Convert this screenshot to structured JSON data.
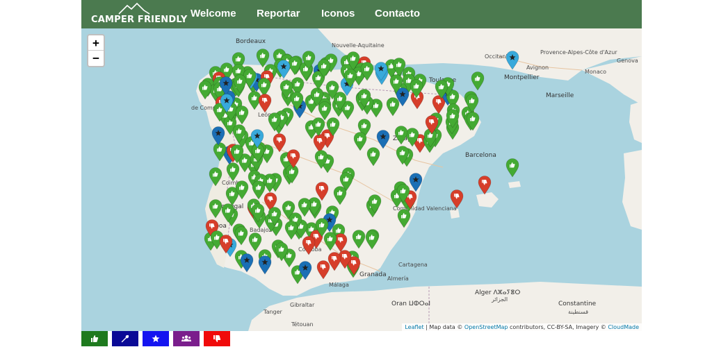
{
  "navbar": {
    "logo_text": "CAMPER FRIENDLY",
    "links": [
      {
        "label": "Welcome"
      },
      {
        "label": "Reportar"
      },
      {
        "label": "Iconos"
      },
      {
        "label": "Contacto"
      }
    ],
    "background": "#4b7a4f"
  },
  "map": {
    "zoom_in": "+",
    "zoom_out": "−",
    "labels": [
      {
        "text": "Bordeaux",
        "kind": "city"
      },
      {
        "text": "Toulouse",
        "kind": "city"
      },
      {
        "text": "Montpellier",
        "kind": "city"
      },
      {
        "text": "Avignon",
        "kind": "city"
      },
      {
        "text": "Marseille",
        "kind": "city"
      },
      {
        "text": "Monaco",
        "kind": "city"
      },
      {
        "text": "Genova",
        "kind": "city"
      },
      {
        "text": "Nouvelle-Aquitaine",
        "kind": "region"
      },
      {
        "text": "Occitanie",
        "kind": "region"
      },
      {
        "text": "Provence-Alpes-Côte d'Azur",
        "kind": "region"
      },
      {
        "text": "de Compostela",
        "kind": "city"
      },
      {
        "text": "León",
        "kind": "city"
      },
      {
        "text": "Zaragoza",
        "kind": "city"
      },
      {
        "text": "Barcelona",
        "kind": "city"
      },
      {
        "text": "Coimbra",
        "kind": "city"
      },
      {
        "text": "Portugal",
        "kind": "country"
      },
      {
        "text": "Lisboa",
        "kind": "city"
      },
      {
        "text": "Badajoz",
        "kind": "city"
      },
      {
        "text": "Comunidad Valenciana",
        "kind": "region"
      },
      {
        "text": "Córdoba",
        "kind": "city"
      },
      {
        "text": "Granada",
        "kind": "city"
      },
      {
        "text": "Málaga",
        "kind": "city"
      },
      {
        "text": "Almería",
        "kind": "city"
      },
      {
        "text": "Cartagena",
        "kind": "city"
      },
      {
        "text": "Gibraltar",
        "kind": "city"
      },
      {
        "text": "Oran ⵡⵀⵔⴰⵏ",
        "kind": "city"
      },
      {
        "text": "Alger ⴷⵣⴰⵢⴻⵔ",
        "kind": "city"
      },
      {
        "text": "Constantine",
        "kind": "city"
      },
      {
        "text": "Tétouan",
        "kind": "city"
      },
      {
        "text": "Tanger",
        "kind": "city"
      },
      {
        "text": "الجزائر",
        "kind": "city"
      },
      {
        "text": "قسنطينة",
        "kind": "city"
      }
    ],
    "attribution": {
      "leaflet": "Leaflet",
      "text1": " | Map data © ",
      "osm": "OpenStreetMap",
      "text2": " contributors, CC-BY-SA, Imagery © ",
      "cloudmade": "CloudMade"
    },
    "marker_colors": {
      "thumbs_up": "#44aa33",
      "thumbs_down": "#d63e2a",
      "service": "#1b6fb5",
      "favorite": "#38a9db"
    }
  },
  "filters": [
    {
      "name": "thumbs-up",
      "color": "#1e7a1e",
      "icon": "thumbs-up-icon"
    },
    {
      "name": "service",
      "color": "#0a0a96",
      "icon": "wrench-icon"
    },
    {
      "name": "favorite",
      "color": "#1414f0",
      "icon": "star-icon"
    },
    {
      "name": "community",
      "color": "#7a1e8c",
      "icon": "users-icon"
    },
    {
      "name": "thumbs-down",
      "color": "#f00a0a",
      "icon": "thumbs-down-icon"
    }
  ]
}
